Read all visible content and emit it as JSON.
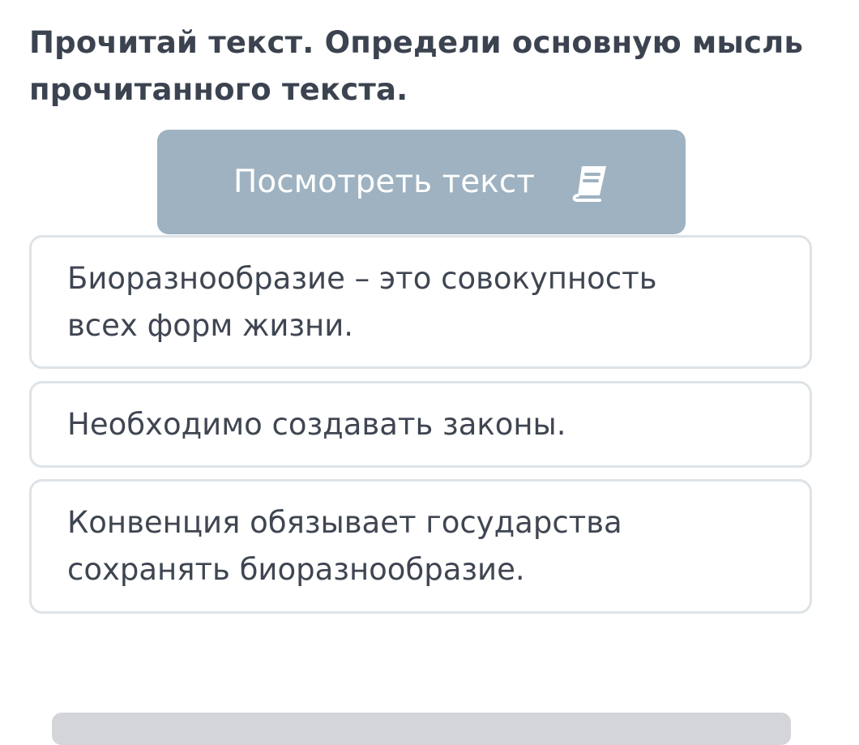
{
  "question": {
    "text": "Прочитай текст. Определи основную мысль прочитанного текста."
  },
  "view_text_button": {
    "label": "Посмотреть текст",
    "icon": "book-icon"
  },
  "options": [
    {
      "text": "Биоразнообразие – это совокупность всех форм жизни."
    },
    {
      "text": "Необходимо создавать законы."
    },
    {
      "text": "Конвенция обязывает государства сохранять биоразнообразие."
    }
  ],
  "colors": {
    "question_text": "#3c4350",
    "button_bg": "#9eb2c1",
    "button_text": "#ffffff",
    "option_border": "#dde3e7",
    "option_text": "#3f4652",
    "bottom_bar": "#d3d5d8"
  }
}
